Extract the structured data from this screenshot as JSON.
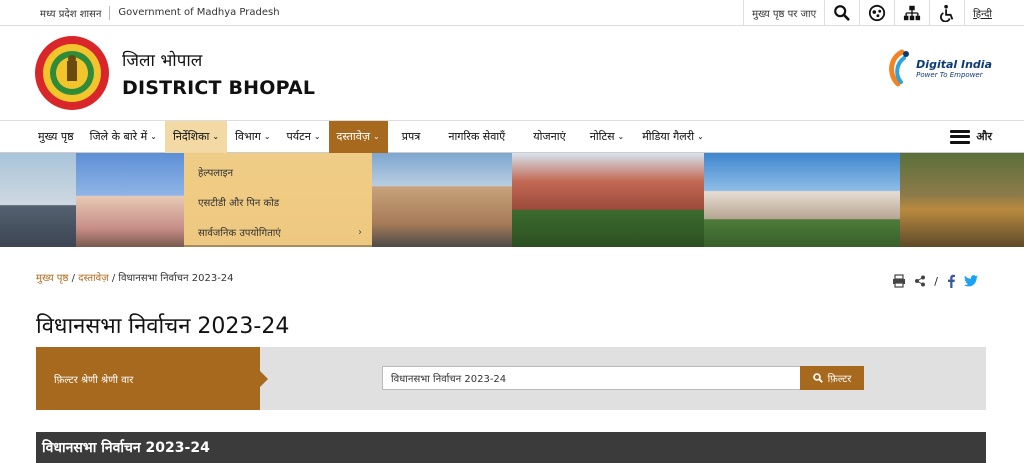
{
  "topbar": {
    "state_hi": "मध्य प्रदेश शासन",
    "state_en": "Government of Madhya Pradesh",
    "skip_link": "मुख्य पृष्ठ पर जाए",
    "lang": "हिन्दी"
  },
  "header": {
    "title_hi": "जिला भोपाल",
    "title_en": "DISTRICT BHOPAL",
    "digital_india": "Digital India",
    "digital_india_tag": "Power To Empower"
  },
  "nav": {
    "items": [
      {
        "label": "मुख्य पृष्ठ",
        "caret": ""
      },
      {
        "label": "जिले के बारे में",
        "caret": "⌄"
      },
      {
        "label": "निर्देशिका",
        "caret": "⌄"
      },
      {
        "label": "विभाग",
        "caret": "⌄"
      },
      {
        "label": "पर्यटन",
        "caret": "⌄"
      },
      {
        "label": "दस्तावेज़",
        "caret": "⌄"
      },
      {
        "label": "प्रपत्र",
        "caret": ""
      },
      {
        "label": "नागरिक सेवाएँ",
        "caret": ""
      },
      {
        "label": "योजनाएं",
        "caret": ""
      },
      {
        "label": "नोटिस",
        "caret": "⌄"
      },
      {
        "label": "मीडिया गैलरी",
        "caret": "⌄"
      }
    ],
    "more": "और"
  },
  "dropdown": {
    "items": [
      "हेल्पलाइन",
      "एसटीडी और पिन कोड",
      "सार्वजनिक उपयोगिताएं"
    ],
    "arrow": "›"
  },
  "breadcrumb": {
    "home": "मुख्य पृष्ठ",
    "sep": "/",
    "docs": "दस्तावेज़",
    "current": "विधानसभा निर्वाचन 2023-24"
  },
  "page_title": "विधानसभा निर्वाचन 2023-24",
  "filter": {
    "label": "फ़िल्टर श्रेणी श्रेणी वार",
    "value": "विधानसभा निर्वाचन 2023-24",
    "button": "फ़िल्टर"
  },
  "table": {
    "heading": "विधानसभा निर्वाचन 2023-24"
  },
  "colors": {
    "accent": "#a6691e",
    "hover": "#f3d9a4"
  }
}
